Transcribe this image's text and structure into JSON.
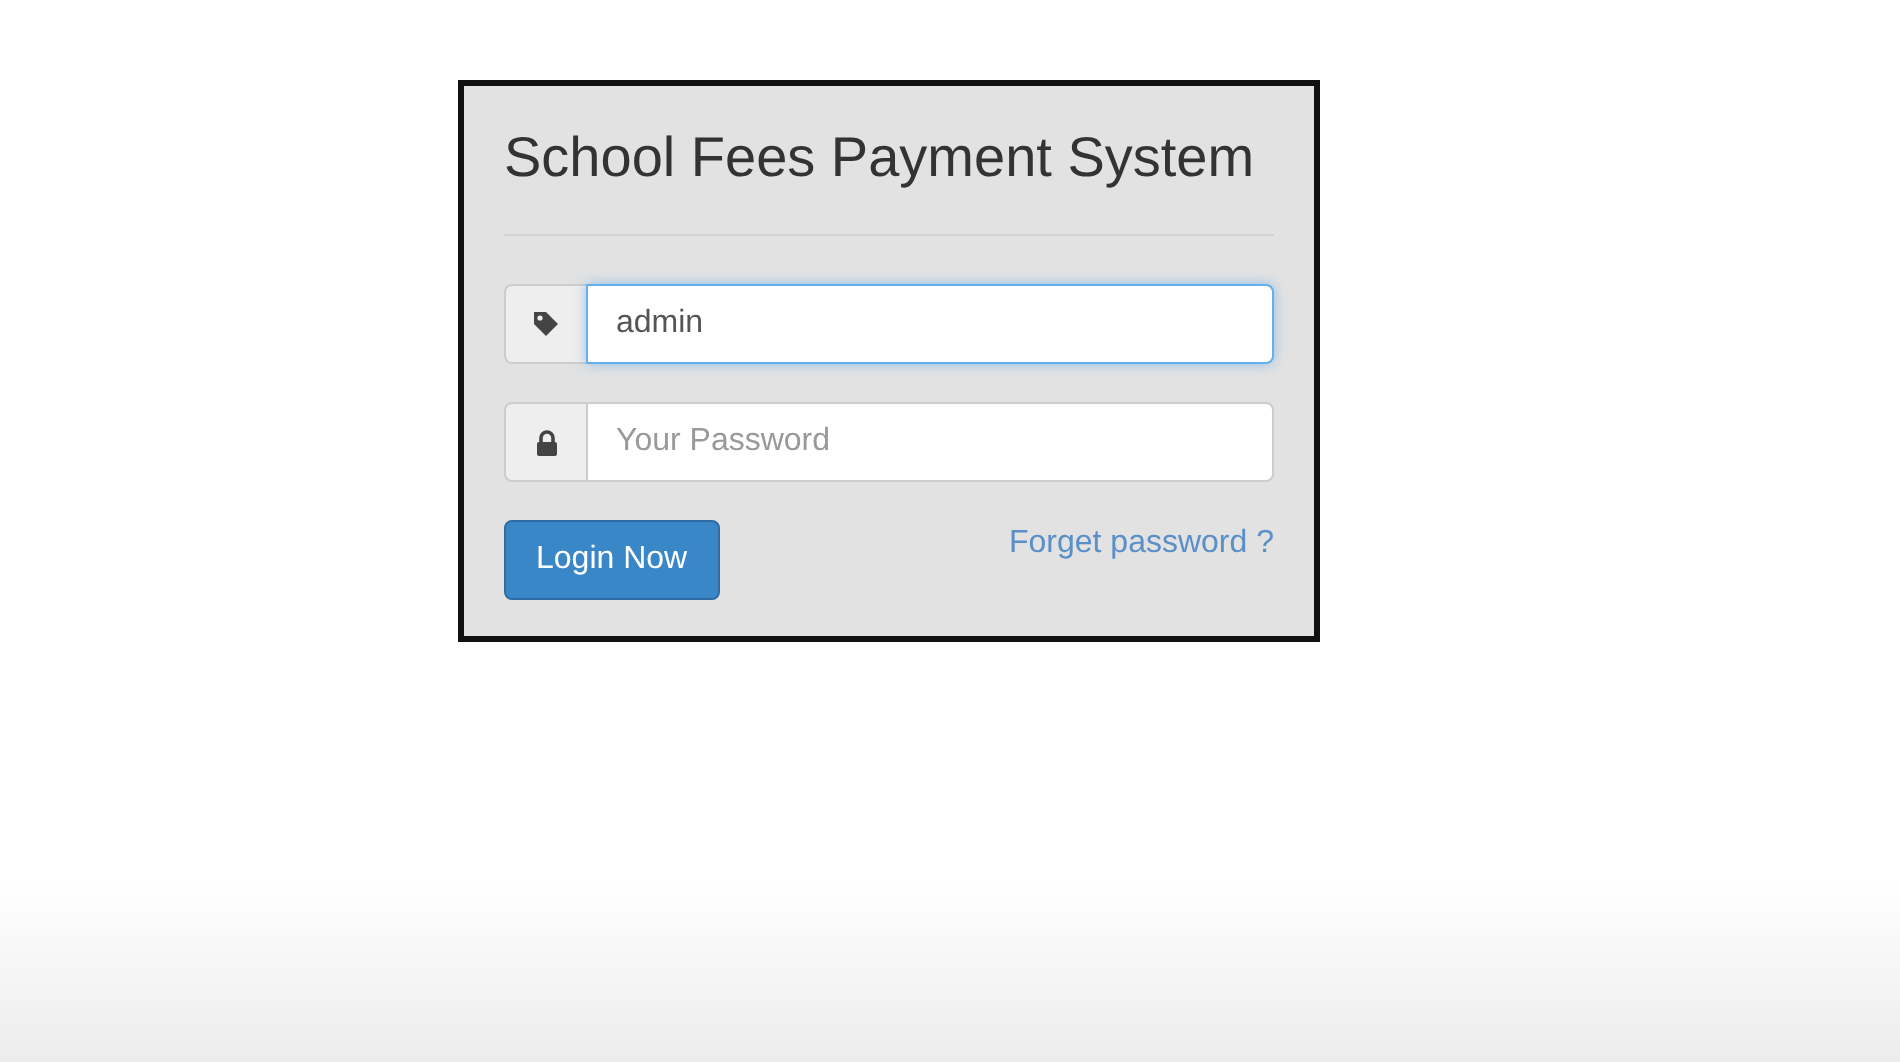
{
  "login_card": {
    "title": "School Fees Payment System",
    "fields": [
      {
        "kind": "username",
        "value": "admin",
        "focused": true
      },
      {
        "kind": "password",
        "placeholder": "Your Password",
        "focused": false
      }
    ],
    "login_button": "Login Now",
    "forgot_link": "Forget password ?"
  }
}
